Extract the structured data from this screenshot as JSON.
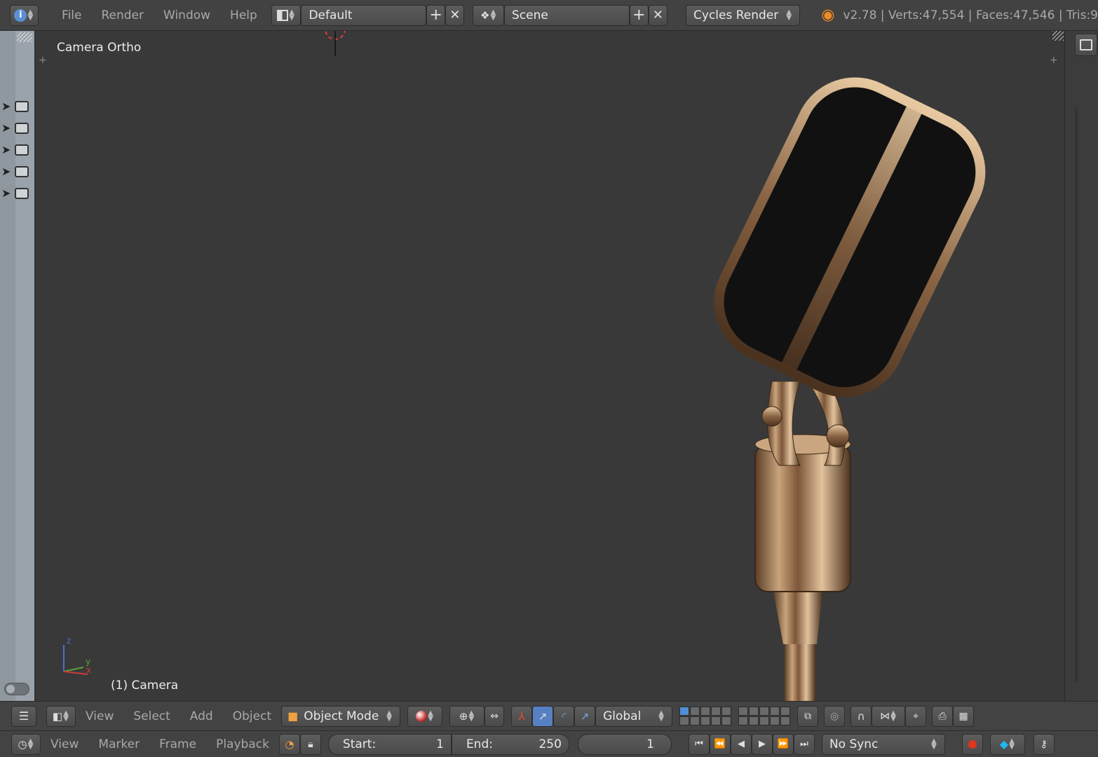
{
  "top_bar": {
    "menus": [
      "File",
      "Render",
      "Window",
      "Help"
    ],
    "layout": "Default",
    "scene": "Scene",
    "render_engine": "Cycles Render",
    "stats": "v2.78 | Verts:47,554 | Faces:47,546 | Tris:9"
  },
  "viewport": {
    "view_name": "Camera Ortho",
    "object_name": "(1) Camera",
    "axis_labels": [
      "z",
      "y",
      "x"
    ]
  },
  "viewport_header": {
    "menus": [
      "View",
      "Select",
      "Add",
      "Object"
    ],
    "mode": "Object Mode",
    "orientation": "Global"
  },
  "timeline": {
    "menus": [
      "View",
      "Marker",
      "Frame",
      "Playback"
    ],
    "start_label": "Start:",
    "start_value": "1",
    "end_label": "End:",
    "end_value": "250",
    "current_frame": "1",
    "sync": "No Sync"
  },
  "colors": {
    "accent_blue": "#5680c2",
    "record_red": "#e0361c",
    "keyframe_cyan": "#20b8f0",
    "brass": "#b08860"
  }
}
